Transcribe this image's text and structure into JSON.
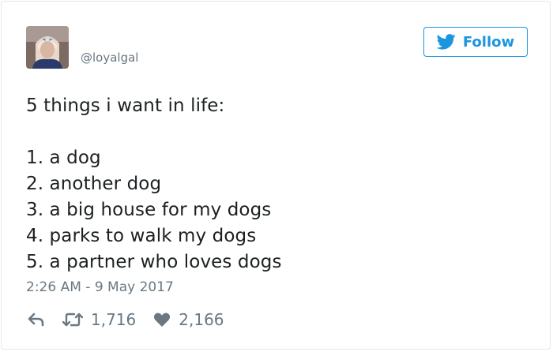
{
  "tweet": {
    "handle": "@loyalgal",
    "follow_label": "Follow",
    "text_lines": [
      "5 things i want in life:",
      "",
      "1. a dog",
      "2. another dog",
      "3. a big house for my dogs",
      "4. parks to walk my dogs",
      "5. a partner who loves dogs"
    ],
    "timestamp": "2:26 AM - 9 May 2017",
    "retweet_count": "1,716",
    "like_count": "2,166"
  },
  "icons": {
    "follow": "twitter-bird-icon",
    "reply": "reply-icon",
    "retweet": "retweet-icon",
    "like": "heart-icon"
  },
  "colors": {
    "accent": "#1b95e0",
    "text": "#1c2022",
    "muted": "#697882",
    "border": "#e1e8ed"
  }
}
